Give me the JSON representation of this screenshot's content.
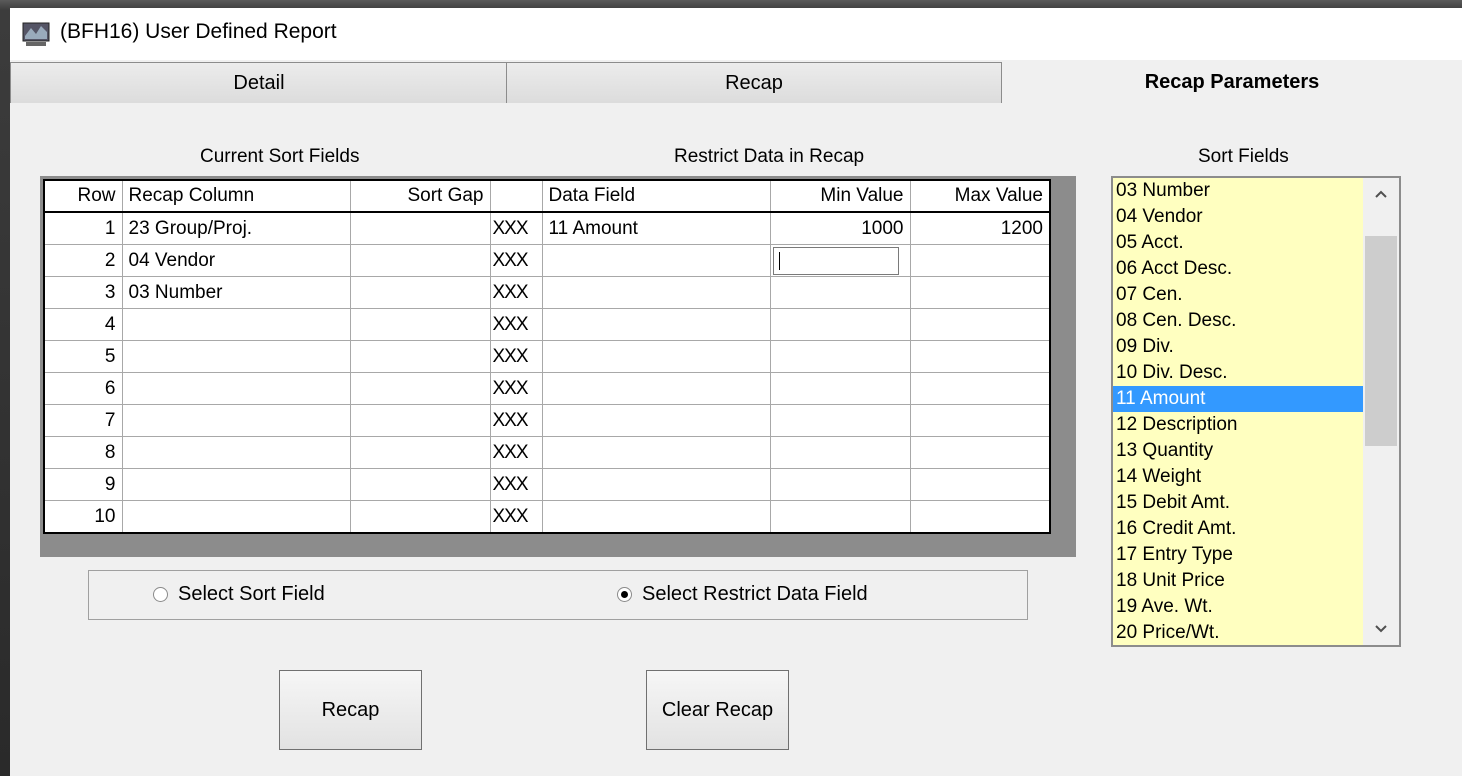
{
  "window": {
    "title": "(BFH16)  User Defined Report",
    "icon": "app-icon"
  },
  "tabs": [
    {
      "label": "Detail",
      "active": false
    },
    {
      "label": "Recap",
      "active": false
    },
    {
      "label": "Recap Parameters",
      "active": true
    }
  ],
  "sections": {
    "current_sort_fields": "Current Sort Fields",
    "restrict_data": "Restrict Data in Recap",
    "sort_fields": "Sort Fields"
  },
  "grid": {
    "headers": [
      "Row",
      "Recap Column",
      "Sort Gap",
      "",
      "Data Field",
      "Min Value",
      "Max Value"
    ],
    "rows": [
      {
        "row": "1",
        "recap_column": "23  Group/Proj.",
        "sort_gap": "",
        "marker": "XXX",
        "data_field": "11  Amount",
        "min": "1000",
        "max": "1200"
      },
      {
        "row": "2",
        "recap_column": "04  Vendor",
        "sort_gap": "",
        "marker": "XXX",
        "data_field": "",
        "min": "",
        "max": ""
      },
      {
        "row": "3",
        "recap_column": "03  Number",
        "sort_gap": "",
        "marker": "XXX",
        "data_field": "",
        "min": "",
        "max": ""
      },
      {
        "row": "4",
        "recap_column": "",
        "sort_gap": "",
        "marker": "XXX",
        "data_field": "",
        "min": "",
        "max": ""
      },
      {
        "row": "5",
        "recap_column": "",
        "sort_gap": "",
        "marker": "XXX",
        "data_field": "",
        "min": "",
        "max": ""
      },
      {
        "row": "6",
        "recap_column": "",
        "sort_gap": "",
        "marker": "XXX",
        "data_field": "",
        "min": "",
        "max": ""
      },
      {
        "row": "7",
        "recap_column": "",
        "sort_gap": "",
        "marker": "XXX",
        "data_field": "",
        "min": "",
        "max": ""
      },
      {
        "row": "8",
        "recap_column": "",
        "sort_gap": "",
        "marker": "XXX",
        "data_field": "",
        "min": "",
        "max": ""
      },
      {
        "row": "9",
        "recap_column": "",
        "sort_gap": "",
        "marker": "XXX",
        "data_field": "",
        "min": "",
        "max": ""
      },
      {
        "row": "10",
        "recap_column": "",
        "sort_gap": "",
        "marker": "XXX",
        "data_field": "",
        "min": "",
        "max": ""
      }
    ]
  },
  "radios": {
    "select_sort_field": {
      "label": "Select Sort Field",
      "checked": false
    },
    "select_restrict_field": {
      "label": "Select Restrict Data Field",
      "checked": true
    }
  },
  "buttons": {
    "recap": "Recap",
    "clear_recap": "Clear Recap"
  },
  "sort_field_list": {
    "items": [
      "03  Number",
      "04  Vendor",
      "05  Acct.",
      "06  Acct Desc.",
      "07  Cen.",
      "08  Cen. Desc.",
      "09  Div.",
      "10  Div. Desc.",
      "11  Amount",
      "12  Description",
      "13  Quantity",
      "14  Weight",
      "15  Debit Amt.",
      "16  Credit Amt.",
      "17  Entry Type",
      "18  Unit Price",
      "19  Ave. Wt.",
      "20  Price/Wt."
    ],
    "selected": "11  Amount",
    "selection_color": "#3399ff",
    "background_color": "#ffffc0"
  }
}
